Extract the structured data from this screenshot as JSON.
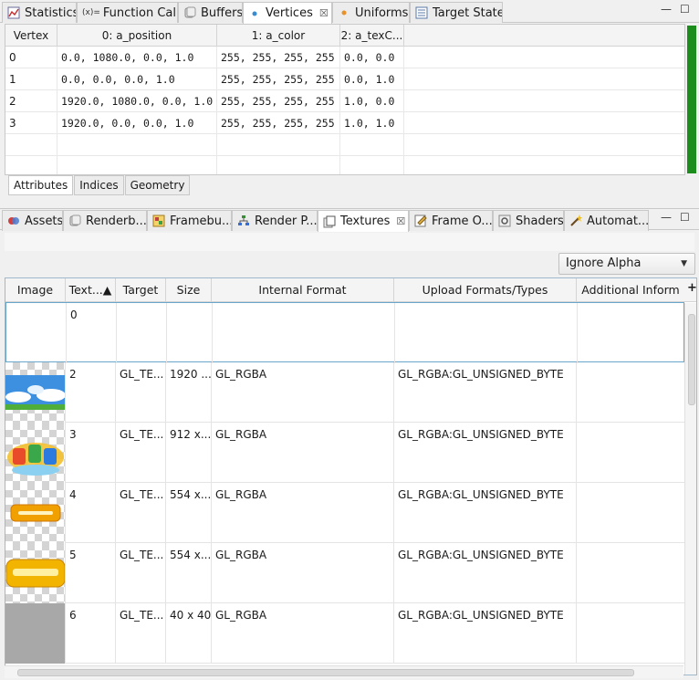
{
  "top_tabs": [
    {
      "label": "Statistics"
    },
    {
      "label": "Function Call",
      "prefix": "(x)="
    },
    {
      "label": "Buffers"
    },
    {
      "label": "Vertices",
      "close": "☒"
    },
    {
      "label": "Uniforms"
    },
    {
      "label": "Target State"
    }
  ],
  "window_controls": {
    "minimize": "—",
    "maximize": "☐"
  },
  "vertices": {
    "headers": [
      "Vertex",
      "0: a_position",
      "1: a_color",
      "2: a_texC..."
    ],
    "rows": [
      [
        "0",
        "0.0, 1080.0, 0.0, 1.0",
        "255, 255, 255, 255",
        "0.0, 0.0"
      ],
      [
        "1",
        "0.0, 0.0, 0.0, 1.0",
        "255, 255, 255, 255",
        "0.0, 1.0"
      ],
      [
        "2",
        "1920.0, 1080.0, 0.0, 1.0",
        "255, 255, 255, 255",
        "1.0, 0.0"
      ],
      [
        "3",
        "1920.0, 0.0, 0.0, 1.0",
        "255, 255, 255, 255",
        "1.0, 1.0"
      ]
    ],
    "subtabs": [
      "Attributes",
      "Indices",
      "Geometry"
    ]
  },
  "bottom_tabs": [
    {
      "label": "Assets"
    },
    {
      "label": "Renderb..."
    },
    {
      "label": "Framebu..."
    },
    {
      "label": "Render P..."
    },
    {
      "label": "Textures",
      "close": "☒"
    },
    {
      "label": "Frame O..."
    },
    {
      "label": "Shaders"
    },
    {
      "label": "Automat..."
    }
  ],
  "alpha_dropdown": {
    "value": "Ignore Alpha",
    "caret": "▼"
  },
  "textures": {
    "headers": [
      "Image",
      "Text...▲",
      "Target",
      "Size",
      "Internal Format",
      "Upload Formats/Types",
      "Additional Inform"
    ],
    "plus": "+",
    "rows": [
      {
        "id": "0",
        "target": "",
        "size": "",
        "internal": "",
        "upload": "",
        "thumb": "none"
      },
      {
        "id": "2",
        "target": "GL_TE...",
        "size": "1920 ...",
        "internal": "GL_RGBA",
        "upload": "GL_RGBA:GL_UNSIGNED_BYTE",
        "thumb": "sky"
      },
      {
        "id": "3",
        "target": "GL_TE...",
        "size": "912 x...",
        "internal": "GL_RGBA",
        "upload": "GL_RGBA:GL_UNSIGNED_BYTE",
        "thumb": "logo"
      },
      {
        "id": "4",
        "target": "GL_TE...",
        "size": "554 x...",
        "internal": "GL_RGBA",
        "upload": "GL_RGBA:GL_UNSIGNED_BYTE",
        "thumb": "button-small"
      },
      {
        "id": "5",
        "target": "GL_TE...",
        "size": "554 x...",
        "internal": "GL_RGBA",
        "upload": "GL_RGBA:GL_UNSIGNED_BYTE",
        "thumb": "button-large"
      },
      {
        "id": "6",
        "target": "GL_TE...",
        "size": "40 x 40",
        "internal": "GL_RGBA",
        "upload": "GL_RGBA:GL_UNSIGNED_BYTE",
        "thumb": "gray"
      }
    ]
  },
  "colors": {
    "accent_green": "#1c8c1c",
    "selection_border": "#6aa6cc",
    "button_orange": "#f0a000"
  }
}
